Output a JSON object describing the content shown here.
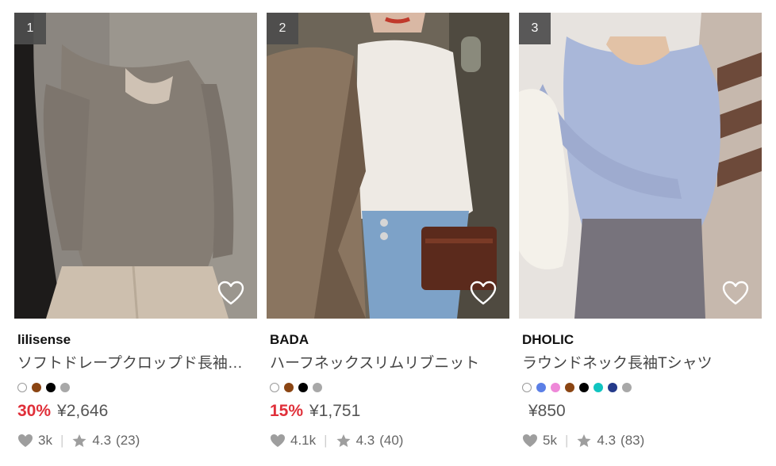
{
  "products": [
    {
      "rank": "1",
      "brand": "lilisense",
      "name": "ソフトドレープクロップド長袖…",
      "colors": [
        "#ffffff",
        "#8b4513",
        "#000000",
        "#a8a8a8"
      ],
      "discount": "30%",
      "price": "¥2,646",
      "likes": "3k",
      "rating": "4.3",
      "reviews": "(23)",
      "image_colors": {
        "bg": "#8e8982",
        "garment": "#877f76",
        "pants": "#cdbfae"
      }
    },
    {
      "rank": "2",
      "brand": "BADA",
      "name": "ハーフネックスリムリブニット",
      "colors": [
        "#ffffff",
        "#8b4513",
        "#000000",
        "#a8a8a8"
      ],
      "discount": "15%",
      "price": "¥1,751",
      "likes": "4.1k",
      "rating": "4.3",
      "reviews": "(40)",
      "image_colors": {
        "bg": "#6d6558",
        "garment": "#eeeae4",
        "pants": "#7da2c8"
      }
    },
    {
      "rank": "3",
      "brand": "DHOLIC",
      "name": "ラウンドネック長袖Tシャツ",
      "colors": [
        "#ffffff",
        "#5b7fe6",
        "#ee88d8",
        "#8b4513",
        "#000000",
        "#10c4c0",
        "#243a8a",
        "#a8a8a8"
      ],
      "discount": "",
      "price": "¥850",
      "likes": "5k",
      "rating": "4.3",
      "reviews": "(83)",
      "image_colors": {
        "bg": "#e7e3df",
        "garment": "#a9b7d9",
        "pants": "#77737c"
      }
    }
  ],
  "ui_colors": {
    "discount": "#e0303a",
    "rank_badge": "#4d4d4d",
    "icon_gray": "#9e9e9e"
  }
}
